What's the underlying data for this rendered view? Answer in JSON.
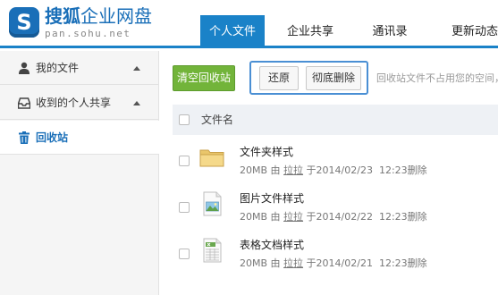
{
  "brand": {
    "logo_letter": "S",
    "title_bold": "搜狐",
    "title_rest": "企业网盘",
    "url": "pan.sohu.net",
    "color": "#1a6fb8"
  },
  "nav": {
    "tabs": [
      {
        "label": "个人文件",
        "active": true
      },
      {
        "label": "企业共享",
        "active": false
      },
      {
        "label": "通讯录",
        "active": false
      },
      {
        "label": "更新动态",
        "active": false
      }
    ],
    "accent": "#1a82c8"
  },
  "sidebar": {
    "items": [
      {
        "label": "我的文件",
        "icon": "user-icon",
        "expandable": true,
        "active": false
      },
      {
        "label": "收到的个人共享",
        "icon": "inbox-icon",
        "expandable": true,
        "active": false
      },
      {
        "label": "回收站",
        "icon": "trash-icon",
        "expandable": false,
        "active": true
      }
    ]
  },
  "toolbar": {
    "clear_label": "清空回收站",
    "restore_label": "还原",
    "delete_label": "彻底删除",
    "hint": "回收站文件不占用您的空间，",
    "clear_color": "#72b43a"
  },
  "list": {
    "header": "文件名",
    "rows": [
      {
        "name": "文件夹样式",
        "type": "folder-icon",
        "size": "20MB",
        "by": "由",
        "user": "拉拉",
        "date": "于2014/02/23",
        "time": "12:23删除"
      },
      {
        "name": "图片文件样式",
        "type": "image-file-icon",
        "size": "20MB",
        "by": "由",
        "user": "拉拉",
        "date": "于2014/02/22",
        "time": "12:23删除"
      },
      {
        "name": "表格文档样式",
        "type": "spreadsheet-file-icon",
        "size": "20MB",
        "by": "由",
        "user": "拉拉",
        "date": "于2014/02/21",
        "time": "12:23删除"
      }
    ]
  }
}
